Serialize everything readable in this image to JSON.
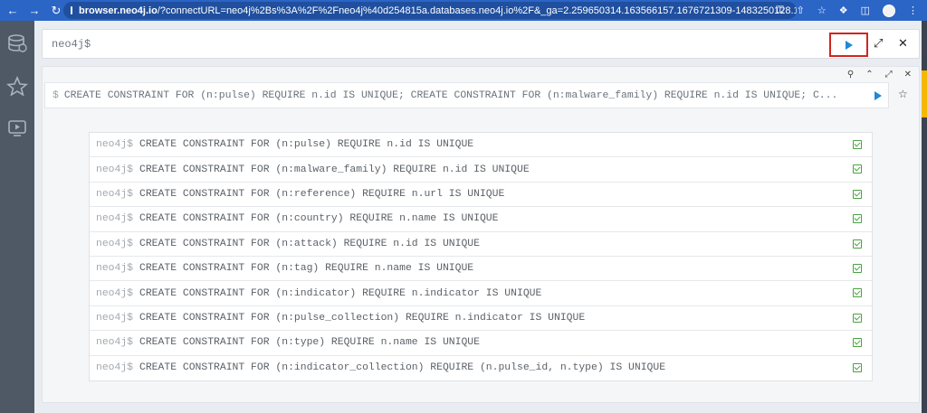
{
  "browser": {
    "url_host": "browser.neo4j.io",
    "url_rest": "/?connectURL=neo4j%2Bs%3A%2F%2Fneo4j%40d254815a.databases.neo4j.io%2F&_ga=2.259650314.163566157.1676721309-1483250128.1..."
  },
  "sidebar": {
    "items": [
      {
        "icon": "database-icon"
      },
      {
        "icon": "star-icon"
      },
      {
        "icon": "play-screen-icon"
      }
    ]
  },
  "editor": {
    "prompt": "neo4j$",
    "run_button_icon": "play-icon",
    "expand_icon": "expand-icon",
    "close_icon": "close-icon"
  },
  "frame": {
    "command": "CREATE CONSTRAINT FOR (n:pulse) REQUIRE n.id IS UNIQUE; CREATE CONSTRAINT FOR (n:malware_family) REQUIRE n.id IS UNIQUE; C...",
    "dollar": "$",
    "tools": [
      "pin-icon",
      "collapse-icon",
      "fullscreen-icon",
      "close-icon"
    ]
  },
  "results": {
    "prompt": "neo4j$",
    "rows": [
      "CREATE CONSTRAINT FOR (n:pulse) REQUIRE n.id IS UNIQUE",
      "CREATE CONSTRAINT FOR (n:malware_family) REQUIRE n.id IS UNIQUE",
      "CREATE CONSTRAINT FOR (n:reference) REQUIRE n.url IS UNIQUE",
      "CREATE CONSTRAINT FOR (n:country) REQUIRE n.name IS UNIQUE",
      "CREATE CONSTRAINT FOR (n:attack) REQUIRE n.id IS UNIQUE",
      "CREATE CONSTRAINT FOR (n:tag) REQUIRE n.name IS UNIQUE",
      "CREATE CONSTRAINT FOR (n:indicator) REQUIRE n.indicator IS UNIQUE",
      "CREATE CONSTRAINT FOR (n:pulse_collection) REQUIRE n.indicator IS UNIQUE",
      "CREATE CONSTRAINT FOR (n:type) REQUIRE n.name IS UNIQUE",
      "CREATE CONSTRAINT FOR (n:indicator_collection) REQUIRE (n.pulse_id, n.type) IS UNIQUE"
    ],
    "status_icon": "success-check-icon"
  },
  "colors": {
    "chrome": "#2b65c6",
    "sidebar": "#4f5865",
    "run_highlight": "#d0251f",
    "play_blue": "#1f88d8",
    "success_green": "#4aa241"
  }
}
